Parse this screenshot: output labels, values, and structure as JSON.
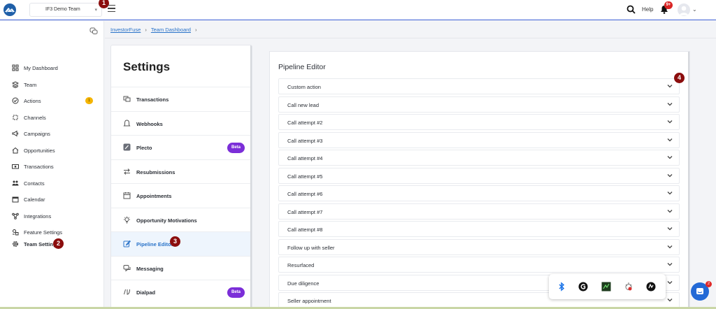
{
  "topbar": {
    "team_name": "IF3 Demo Team",
    "help_label": "Help",
    "notifications_count": "9+",
    "marker_1": "1"
  },
  "sidebar": {
    "items": [
      {
        "label": "My Dashboard",
        "icon": "grid-icon"
      },
      {
        "label": "Team",
        "icon": "layers-icon"
      },
      {
        "label": "Actions",
        "icon": "check-circle-icon",
        "count": "1"
      },
      {
        "label": "Channels",
        "icon": "channels-icon"
      },
      {
        "label": "Campaigns",
        "icon": "megaphone-icon"
      },
      {
        "label": "Opportunities",
        "icon": "home-icon"
      },
      {
        "label": "Transactions",
        "icon": "cash-icon"
      },
      {
        "label": "Contacts",
        "icon": "people-icon"
      },
      {
        "label": "Calendar",
        "icon": "calendar-icon"
      },
      {
        "label": "Integrations",
        "icon": "integrations-icon"
      },
      {
        "label": "Feature Settings",
        "icon": "feature-settings-icon"
      },
      {
        "label": "Team Settings",
        "icon": "gear-icon"
      }
    ],
    "marker_2": "2"
  },
  "breadcrumb": [
    "InvestorFuse",
    "Team Dashboard"
  ],
  "settings": {
    "title": "Settings",
    "items": [
      {
        "label": "Transactions",
        "icon": "transactions-icon"
      },
      {
        "label": "Webhooks",
        "icon": "bell-icon"
      },
      {
        "label": "Plecto",
        "icon": "plecto-icon",
        "badge": "Beta"
      },
      {
        "label": "Resubmissions",
        "icon": "swap-icon"
      },
      {
        "label": "Appointments",
        "icon": "calendar-icon"
      },
      {
        "label": "Opportunity Motivations",
        "icon": "lightbulb-icon"
      },
      {
        "label": "Pipeline Editor",
        "icon": "edit-icon",
        "active": true
      },
      {
        "label": "Messaging",
        "icon": "chat-icon"
      },
      {
        "label": "Dialpad",
        "icon": "dialpad-icon",
        "badge": "Beta"
      }
    ],
    "marker_3": "3"
  },
  "pipeline": {
    "title": "Pipeline Editor",
    "stages": [
      "Custom action",
      "Call new lead",
      "Call attempt #2",
      "Call attempt #3",
      "Call attempt #4",
      "Call attempt #5",
      "Call attempt #6",
      "Call attempt #7",
      "Call attempt #8",
      "Follow up with seller",
      "Resurfaced",
      "Due diligence",
      "Seller appointment"
    ],
    "marker_4": "4"
  },
  "chat_count": "2",
  "colors": {
    "accent": "#2a73c9",
    "beta": "#7b2ed8",
    "marker": "#8b0d0d",
    "topbar_border": "#3d5fd6"
  }
}
